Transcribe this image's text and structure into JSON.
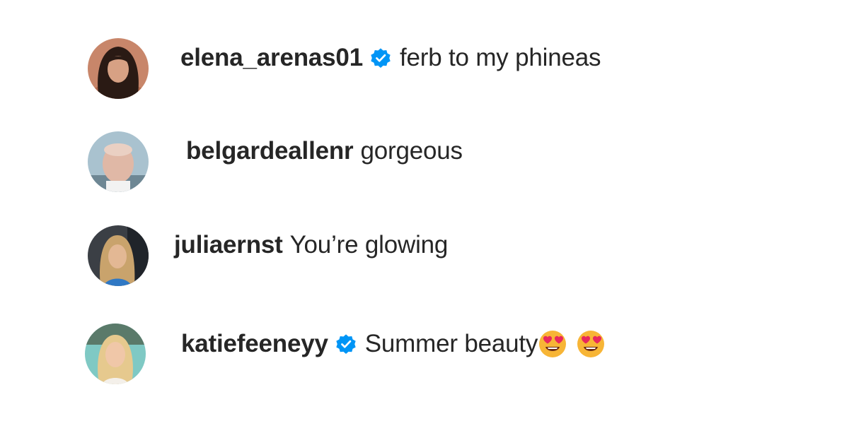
{
  "comments": [
    {
      "username": "elena_arenas01",
      "verified": true,
      "text": "ferb to my phineas",
      "avatar": "profile-photo-woman-dark-hair"
    },
    {
      "username": "belgardeallenr",
      "verified": false,
      "text": "gorgeous",
      "avatar": "profile-photo-man-bald"
    },
    {
      "username": "juliaernst",
      "verified": false,
      "text": "You’re glowing",
      "avatar": "profile-photo-woman-blonde-car"
    },
    {
      "username": "katiefeeneyy",
      "verified": true,
      "text": "Summer beauty",
      "emoji": [
        "smiling-face-with-heart-eyes",
        "smiling-face-with-heart-eyes"
      ],
      "avatar": "profile-photo-woman-blonde-pool"
    }
  ],
  "colors": {
    "text": "#262626",
    "verified_badge": "#0095f6",
    "background": "#ffffff"
  }
}
